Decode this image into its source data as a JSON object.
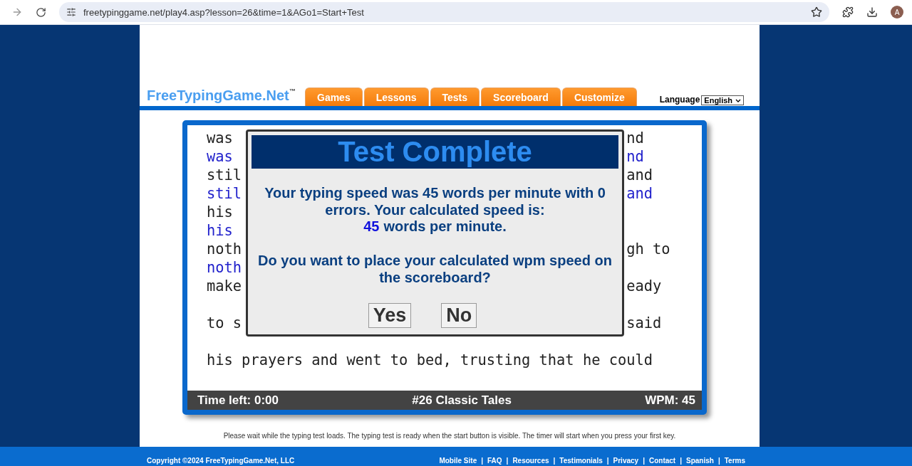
{
  "browser": {
    "url": "freetypinggame.net/play4.asp?lesson=26&time=1&AGo1=Start+Test",
    "avatar": "A"
  },
  "header": {
    "logo": "FreeTypingGame.Net$^{™}$",
    "tabs": [
      "Games",
      "Lessons",
      "Tests",
      "Scoreboard",
      "Customize"
    ],
    "language_label": "Language",
    "language_value": "English"
  },
  "typing_text": [
    {
      "kind": "text",
      "left": "was",
      "right": "nd",
      "typed": false
    },
    {
      "kind": "text",
      "left": "was",
      "right": "nd",
      "typed": true
    },
    {
      "kind": "text",
      "left": "stil",
      "right": "and",
      "typed": false
    },
    {
      "kind": "text",
      "left": "stil",
      "right": "and",
      "typed": true
    },
    {
      "kind": "text",
      "left": "his",
      "typed": false
    },
    {
      "kind": "text",
      "left": "his",
      "typed": true
    },
    {
      "kind": "text",
      "left": "noth",
      "right": "gh to",
      "typed": false
    },
    {
      "kind": "text",
      "left": "noth",
      "typed": true
    },
    {
      "kind": "text",
      "left": "make",
      "right": "eady",
      "typed": false
    },
    {
      "kind": "blank"
    },
    {
      "kind": "text",
      "left": "to s",
      "right": "said",
      "typed": false
    },
    {
      "kind": "blank"
    },
    {
      "kind": "text",
      "left": "his prayers and went to bed, trusting that he could",
      "typed": false
    }
  ],
  "status_bar": {
    "time_left": "Time left: 0:00",
    "lesson": "#26 Classic Tales",
    "wpm": "WPM: 45"
  },
  "dialog": {
    "title": "Test Complete",
    "message": "Your typing speed was 45 words per minute with 0 errors. Your calculated speed is:",
    "calculated_value": "45",
    "calculated_unit": "words per minute.",
    "question": "Do you want to place your calculated wpm speed on the scoreboard?",
    "buttons": [
      "Yes",
      "No"
    ]
  },
  "notice": "Please wait while the typing test loads. The typing test is ready when the start button is visible. The timer will start when you press your first key.",
  "footer": {
    "copyright": "Copyright ©2024 FreeTypingGame.Net, LLC",
    "separator": "|",
    "links": [
      "Mobile Site",
      "FAQ",
      "Resources",
      "Testimonials",
      "Privacy",
      "Contact",
      "Spanish",
      "Terms"
    ]
  }
}
